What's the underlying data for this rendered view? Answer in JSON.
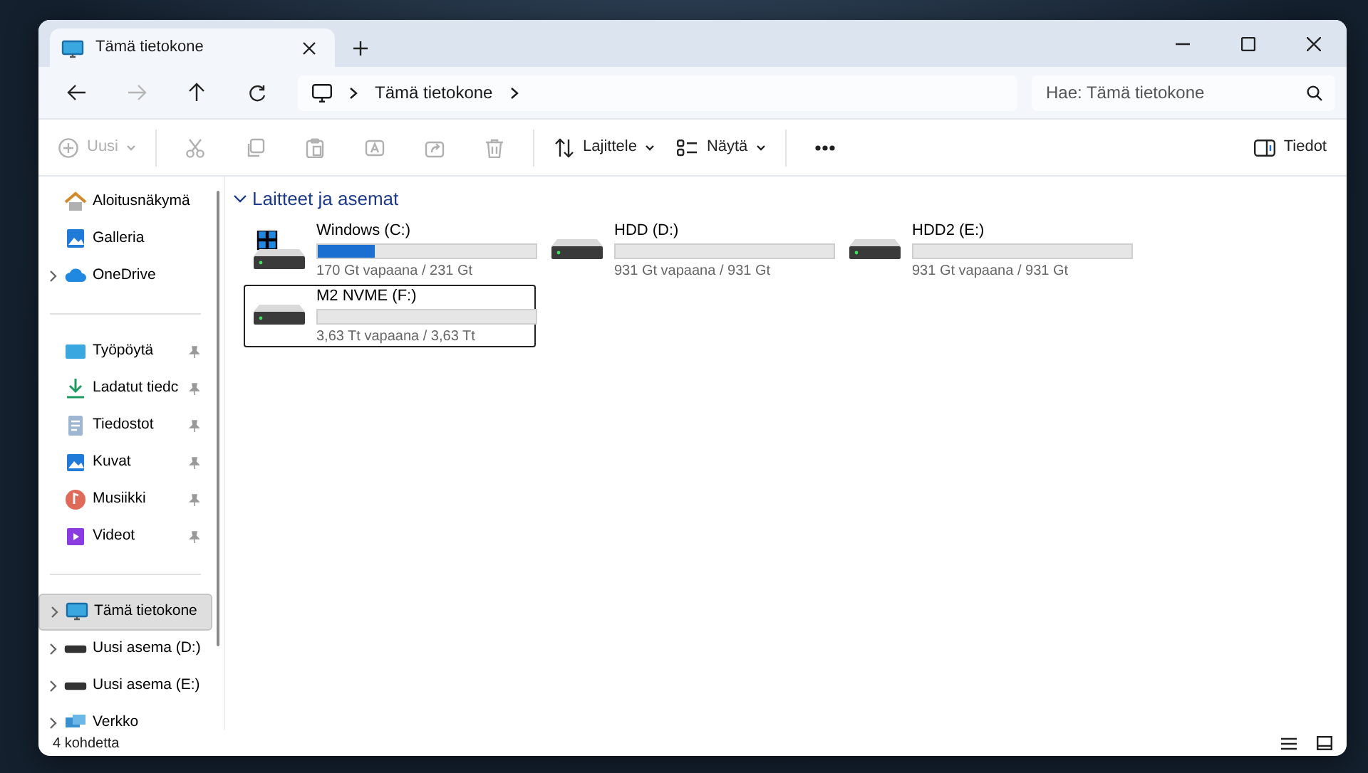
{
  "window": {
    "tab": {
      "title": "Tämä tietokone"
    }
  },
  "address_bar": {
    "breadcrumb": [
      "Tämä tietokone"
    ],
    "search": {
      "placeholder": "Hae: Tämä tietokone"
    },
    "forward_disabled": true
  },
  "toolbar": {
    "new_button": {
      "label": "Uusi",
      "disabled": true
    },
    "actions": [
      {
        "disabled": true
      },
      {
        "disabled": true
      },
      {
        "disabled": true
      },
      {
        "disabled": true
      },
      {
        "disabled": true
      },
      {
        "disabled": true
      }
    ],
    "sort_button": {
      "label": "Lajittele",
      "disabled": false
    },
    "view_button": {
      "label": "Näytä",
      "disabled": false
    },
    "details_button": {
      "label": "Tiedot"
    }
  },
  "sidebar": {
    "sections": [
      [
        {
          "label": "Aloitusnäkymä",
          "expandable": false,
          "pinned": false,
          "selected": false
        },
        {
          "label": "Galleria",
          "expandable": false,
          "pinned": false,
          "selected": false
        },
        {
          "label": "OneDrive",
          "expandable": true,
          "pinned": false,
          "selected": false
        }
      ],
      [
        {
          "label": "Työpöytä",
          "expandable": false,
          "pinned": true,
          "selected": false
        },
        {
          "label": "Ladatut tiedc",
          "expandable": false,
          "pinned": true,
          "selected": false
        },
        {
          "label": "Tiedostot",
          "expandable": false,
          "pinned": true,
          "selected": false
        },
        {
          "label": "Kuvat",
          "expandable": false,
          "pinned": true,
          "selected": false
        },
        {
          "label": "Musiikki",
          "expandable": false,
          "pinned": true,
          "selected": false
        },
        {
          "label": "Videot",
          "expandable": false,
          "pinned": true,
          "selected": false
        }
      ],
      [
        {
          "label": "Tämä tietokone",
          "expandable": true,
          "pinned": false,
          "selected": true
        },
        {
          "label": "Uusi asema (D:)",
          "expandable": true,
          "pinned": false,
          "selected": false
        },
        {
          "label": "Uusi asema (E:)",
          "expandable": true,
          "pinned": false,
          "selected": false
        },
        {
          "label": "Verkko",
          "expandable": true,
          "pinned": false,
          "selected": false
        }
      ]
    ]
  },
  "content": {
    "group": {
      "title": "Laitteet ja asemat",
      "expanded": true
    },
    "drives": [
      {
        "name": "Windows (C:)",
        "kind": "system",
        "level": 0.264,
        "reading": "170 Gt vapaana / 231 Gt",
        "selected": false
      },
      {
        "name": "HDD (D:)",
        "kind": "disk",
        "level": 0,
        "reading": "931 Gt vapaana / 931 Gt",
        "selected": false
      },
      {
        "name": "HDD2 (E:)",
        "kind": "disk",
        "level": 0,
        "reading": "931 Gt vapaana / 931 Gt",
        "selected": false
      },
      {
        "name": "M2 NVME  (F:)",
        "kind": "disk",
        "level": 0,
        "reading": "3,63 Tt vapaana / 3,63 Tt",
        "selected": true
      }
    ]
  },
  "status_bar": {
    "item_count": "4 kohdetta"
  }
}
